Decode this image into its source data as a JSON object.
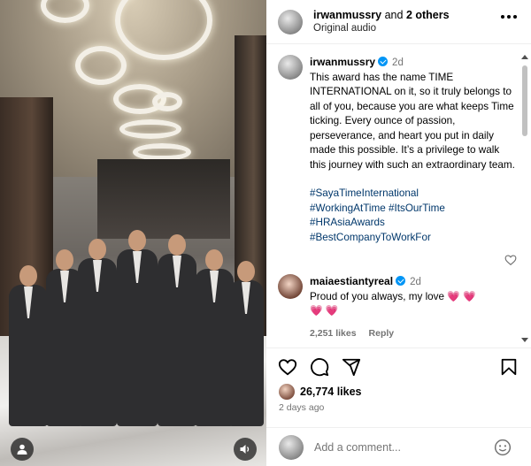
{
  "header": {
    "author": "irwanmussry",
    "and_text": " and ",
    "others": "2 others",
    "subtitle": "Original audio"
  },
  "caption": {
    "username": "irwanmussry",
    "time": "2d",
    "text": "This award has the name TIME INTERNATIONAL on it, so it truly belongs to all of you, because you are what keeps Time ticking. Every ounce of passion, perseverance, and heart you put in daily made this possible. It’s a privilege to walk this journey with such an extraordinary team.",
    "hashtags": [
      "#SayaTimeInternational",
      "#WorkingAtTime #ItsOurTime",
      "#HRAsiaAwards",
      "#BestCompanyToWorkFor"
    ]
  },
  "comment": {
    "username": "maiaestiantyreal",
    "time": "2d",
    "text": "Proud of you always, my love",
    "hearts_inline": "💗 💗",
    "hearts_next": "💗 💗",
    "likes": "2,251 likes",
    "reply": "Reply"
  },
  "actions": {
    "likes": "26,774 likes",
    "date": "2 days ago"
  },
  "add_comment": {
    "placeholder": "Add a comment..."
  },
  "colors": {
    "link": "#00376b",
    "verified": "#0095f6",
    "heart": "#ed2456",
    "muted": "#737373"
  }
}
